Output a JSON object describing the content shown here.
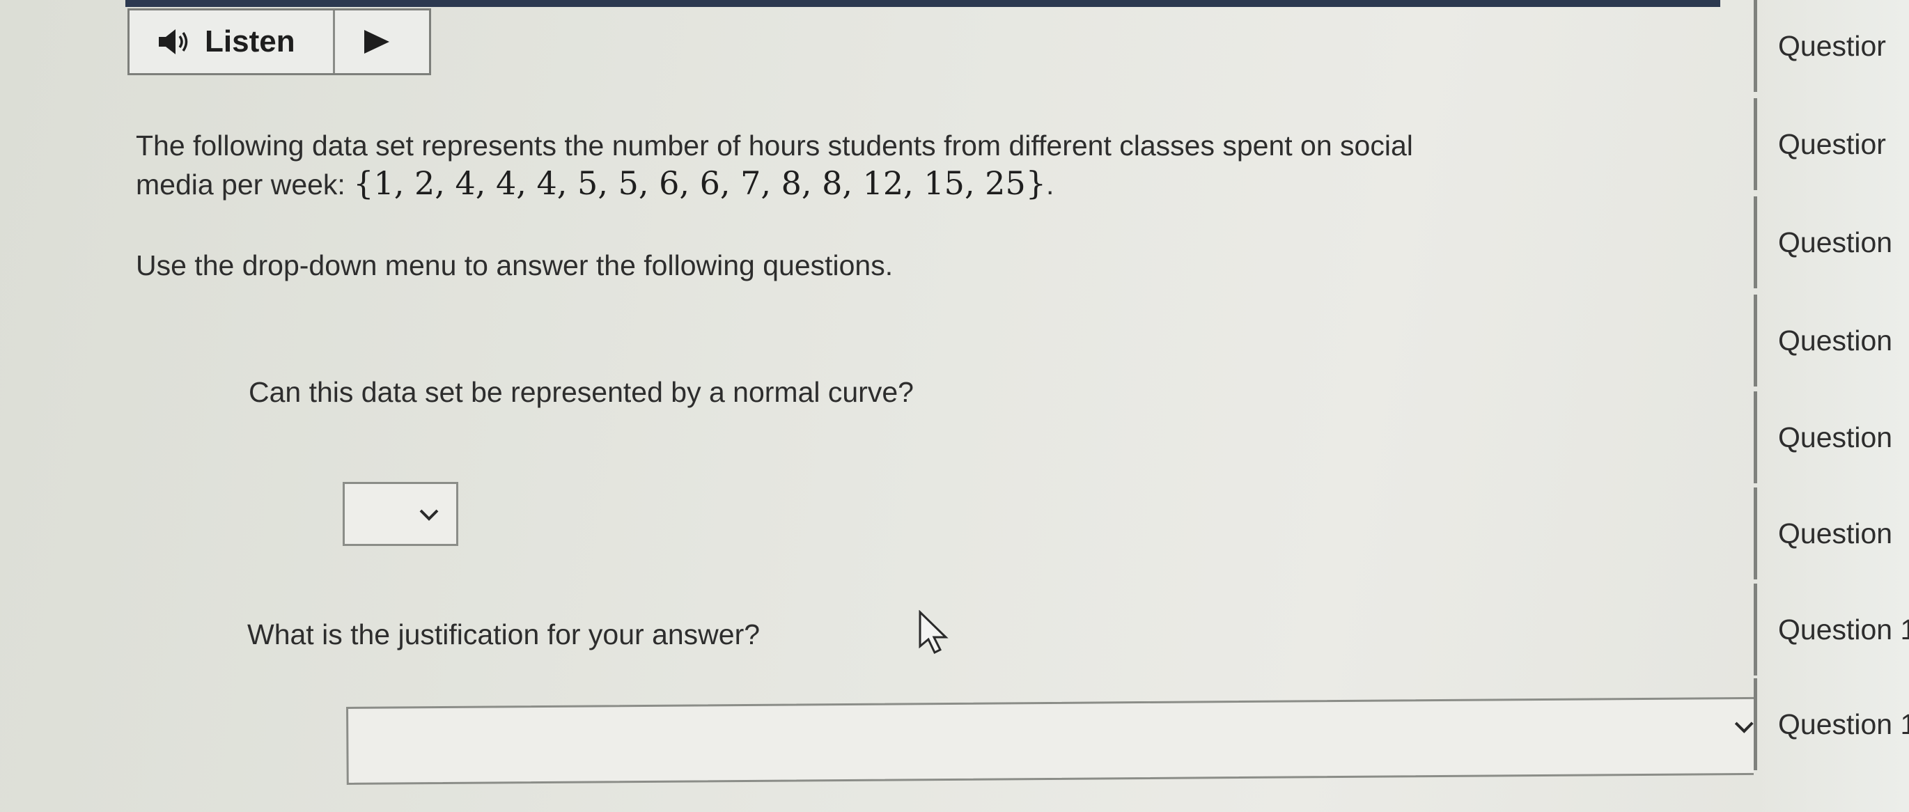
{
  "listen_bar": {
    "listen_label": "Listen",
    "speaker_icon": "speaker-icon",
    "play_icon": "play-icon"
  },
  "content": {
    "intro_line1": "The following data set represents the number of hours students from different classes spent on social",
    "intro_line2_prefix": "media per week:",
    "data_set_display": "{1, 2, 4, 4, 4, 5, 5, 6, 6, 7, 8, 8, 12, 15, 25}",
    "intro_line2_suffix": ".",
    "instruction": "Use the drop-down menu to answer the following questions.",
    "question1": "Can this data set be represented by a normal curve?",
    "question2": "What is the justification for your answer?",
    "dropdown1_value": "",
    "dropdown2_value": ""
  },
  "sidebar": {
    "items": [
      {
        "label": "Questior"
      },
      {
        "label": "Questior"
      },
      {
        "label": "Question"
      },
      {
        "label": "Question"
      },
      {
        "label": "Question"
      },
      {
        "label": "Question"
      },
      {
        "label": "Question 1"
      },
      {
        "label": "Question 1"
      }
    ]
  },
  "colors": {
    "top_strip": "#2c3950",
    "border": "#7d7f7b",
    "background": "#e6e7e1"
  }
}
